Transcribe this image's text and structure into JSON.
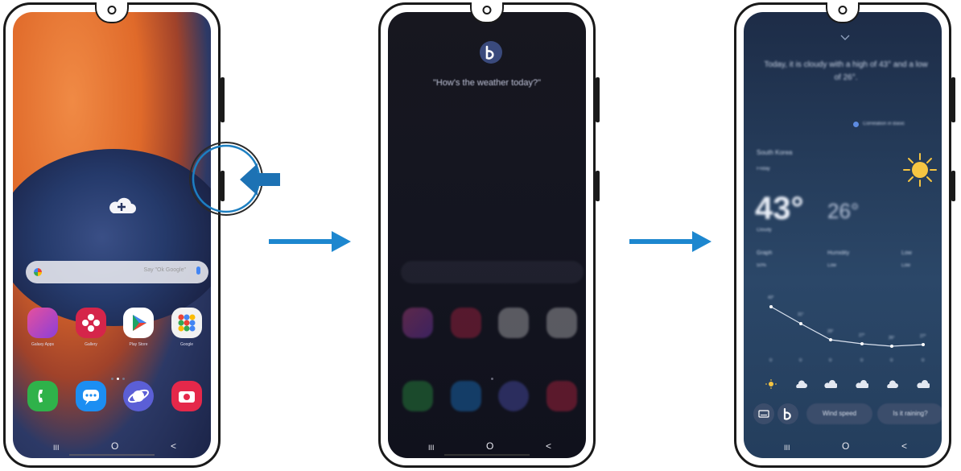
{
  "phone1": {
    "search_placeholder": "Say \"Ok Google\"",
    "apps": [
      "Galaxy Apps",
      "Gallery",
      "Play Store",
      "Google"
    ],
    "dock": [
      "Phone",
      "Messages",
      "Internet",
      "Camera"
    ],
    "nav": {
      "recent": "III",
      "home": "O",
      "back": "<"
    }
  },
  "phone2": {
    "bixby_query": "\"How's the weather today?\"",
    "nav": {
      "recent": "III",
      "home": "O",
      "back": "<"
    }
  },
  "phone3": {
    "response": "Today, it is cloudy with a high of 43° and a low of 26°.",
    "source": "Correlation in Basic",
    "location": "South Korea",
    "day": "Friday",
    "temp_high": "43°",
    "temp_low": "26°",
    "condition": "Cloudy",
    "stats": [
      {
        "label": "Graph",
        "value": "50%"
      },
      {
        "label": "Humidity",
        "value": "Low"
      },
      {
        "label": "Low",
        "value": "Low"
      }
    ],
    "hourly_temps": [
      "43°",
      "31°",
      "29°",
      "27°",
      "26°",
      "27°"
    ],
    "hourly_precip": [
      "0",
      "0",
      "0",
      "0",
      "0",
      "0"
    ],
    "chips": [
      "Wind speed",
      "Is it raining?"
    ],
    "nav": {
      "recent": "III",
      "home": "O",
      "back": "<"
    }
  }
}
